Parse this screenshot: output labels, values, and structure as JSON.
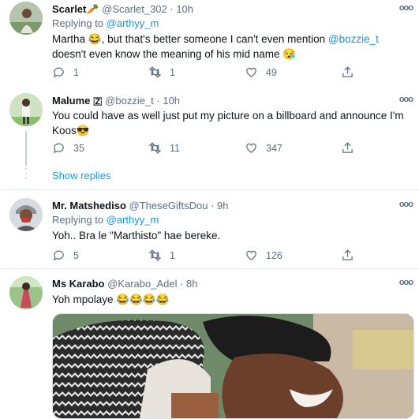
{
  "tweets": [
    {
      "name": "Scarlet🥕",
      "handle": "@Scarlet_302",
      "time": "· 10h",
      "replying_prefix": "Replying to ",
      "replying_to": "@arthyy_m",
      "text_part1": "Martha 😂, but that's better someone I can't even mention ",
      "text_mention": "@bozzie_t",
      "text_part2": " doesn't even know the meaning of his mid name 😪",
      "replies": "1",
      "retweets": "1",
      "likes": "49"
    },
    {
      "name": "Malume 🇿",
      "handle": "@bozzie_t",
      "time": "· 10h",
      "text": "You could have as well just put my picture on a billboard and announce I'm Koos😎",
      "replies": "35",
      "retweets": "11",
      "likes": "347",
      "show_replies": "Show replies"
    },
    {
      "name": "Mr. Matshediso",
      "handle": "@TheseGiftsDou",
      "time": "· 9h",
      "replying_prefix": "Replying to ",
      "replying_to": "@arthyy_m",
      "text": "Yoh.. Bra le \"Marthisto\" hae bereke.",
      "replies": "5",
      "retweets": "1",
      "likes": "126"
    },
    {
      "name": "Ms Karabo",
      "handle": "@Karabo_Adel",
      "time": "· 8h",
      "text": "Yoh mpolaye 😂😂😂😂"
    }
  ],
  "more_label": "ooo",
  "icons": {
    "reply": "reply-icon",
    "retweet": "retweet-icon",
    "like": "heart-icon",
    "share": "share-icon"
  },
  "colors": {
    "link": "#1b95e0",
    "muted": "#5b7083",
    "divider": "#e6ecf0"
  }
}
